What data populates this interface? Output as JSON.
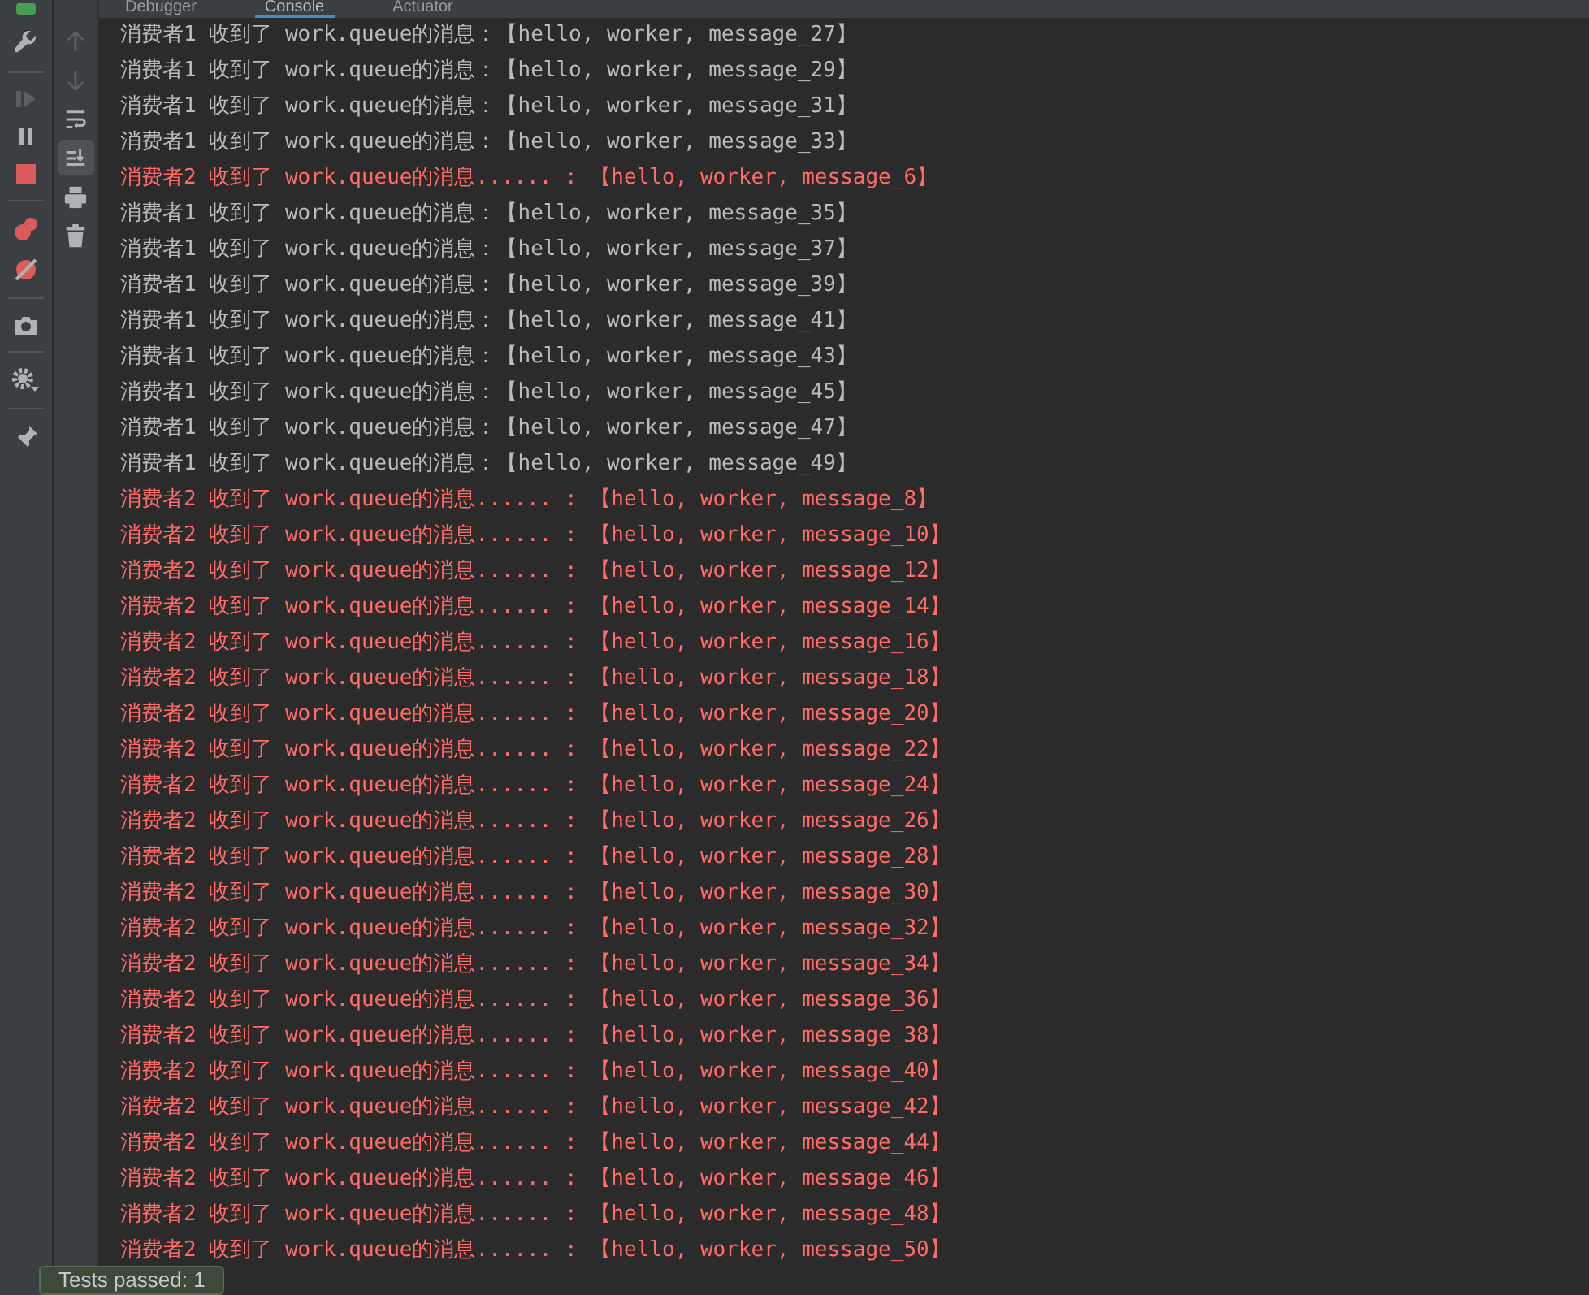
{
  "tabs": [
    {
      "label": "Debugger",
      "selected": false
    },
    {
      "label": "Console",
      "selected": true
    },
    {
      "label": "Actuator",
      "selected": false
    }
  ],
  "console_lines": [
    {
      "kind": "info",
      "text": "消费者1 收到了 work.queue的消息：【hello, worker, message_27】"
    },
    {
      "kind": "info",
      "text": "消费者1 收到了 work.queue的消息：【hello, worker, message_29】"
    },
    {
      "kind": "info",
      "text": "消费者1 收到了 work.queue的消息：【hello, worker, message_31】"
    },
    {
      "kind": "info",
      "text": "消费者1 收到了 work.queue的消息：【hello, worker, message_33】"
    },
    {
      "kind": "error",
      "text": "消费者2 收到了 work.queue的消息...... : 【hello, worker, message_6】"
    },
    {
      "kind": "info",
      "text": "消费者1 收到了 work.queue的消息：【hello, worker, message_35】"
    },
    {
      "kind": "info",
      "text": "消费者1 收到了 work.queue的消息：【hello, worker, message_37】"
    },
    {
      "kind": "info",
      "text": "消费者1 收到了 work.queue的消息：【hello, worker, message_39】"
    },
    {
      "kind": "info",
      "text": "消费者1 收到了 work.queue的消息：【hello, worker, message_41】"
    },
    {
      "kind": "info",
      "text": "消费者1 收到了 work.queue的消息：【hello, worker, message_43】"
    },
    {
      "kind": "info",
      "text": "消费者1 收到了 work.queue的消息：【hello, worker, message_45】"
    },
    {
      "kind": "info",
      "text": "消费者1 收到了 work.queue的消息：【hello, worker, message_47】"
    },
    {
      "kind": "info",
      "text": "消费者1 收到了 work.queue的消息：【hello, worker, message_49】"
    },
    {
      "kind": "error",
      "text": "消费者2 收到了 work.queue的消息...... : 【hello, worker, message_8】"
    },
    {
      "kind": "error",
      "text": "消费者2 收到了 work.queue的消息...... : 【hello, worker, message_10】"
    },
    {
      "kind": "error",
      "text": "消费者2 收到了 work.queue的消息...... : 【hello, worker, message_12】"
    },
    {
      "kind": "error",
      "text": "消费者2 收到了 work.queue的消息...... : 【hello, worker, message_14】"
    },
    {
      "kind": "error",
      "text": "消费者2 收到了 work.queue的消息...... : 【hello, worker, message_16】"
    },
    {
      "kind": "error",
      "text": "消费者2 收到了 work.queue的消息...... : 【hello, worker, message_18】"
    },
    {
      "kind": "error",
      "text": "消费者2 收到了 work.queue的消息...... : 【hello, worker, message_20】"
    },
    {
      "kind": "error",
      "text": "消费者2 收到了 work.queue的消息...... : 【hello, worker, message_22】"
    },
    {
      "kind": "error",
      "text": "消费者2 收到了 work.queue的消息...... : 【hello, worker, message_24】"
    },
    {
      "kind": "error",
      "text": "消费者2 收到了 work.queue的消息...... : 【hello, worker, message_26】"
    },
    {
      "kind": "error",
      "text": "消费者2 收到了 work.queue的消息...... : 【hello, worker, message_28】"
    },
    {
      "kind": "error",
      "text": "消费者2 收到了 work.queue的消息...... : 【hello, worker, message_30】"
    },
    {
      "kind": "error",
      "text": "消费者2 收到了 work.queue的消息...... : 【hello, worker, message_32】"
    },
    {
      "kind": "error",
      "text": "消费者2 收到了 work.queue的消息...... : 【hello, worker, message_34】"
    },
    {
      "kind": "error",
      "text": "消费者2 收到了 work.queue的消息...... : 【hello, worker, message_36】"
    },
    {
      "kind": "error",
      "text": "消费者2 收到了 work.queue的消息...... : 【hello, worker, message_38】"
    },
    {
      "kind": "error",
      "text": "消费者2 收到了 work.queue的消息...... : 【hello, worker, message_40】"
    },
    {
      "kind": "error",
      "text": "消费者2 收到了 work.queue的消息...... : 【hello, worker, message_42】"
    },
    {
      "kind": "error",
      "text": "消费者2 收到了 work.queue的消息...... : 【hello, worker, message_44】"
    },
    {
      "kind": "error",
      "text": "消费者2 收到了 work.queue的消息...... : 【hello, worker, message_46】"
    },
    {
      "kind": "error",
      "text": "消费者2 收到了 work.queue的消息...... : 【hello, worker, message_48】"
    },
    {
      "kind": "error",
      "text": "消费者2 收到了 work.queue的消息...... : 【hello, worker, message_50】"
    }
  ],
  "side_tools": [
    {
      "kind": "up",
      "disabled": true,
      "selected": false
    },
    {
      "kind": "down",
      "disabled": true,
      "selected": false
    },
    {
      "kind": "wrap",
      "disabled": false,
      "selected": false
    },
    {
      "kind": "scroll-end",
      "disabled": false,
      "selected": true
    },
    {
      "kind": "print",
      "disabled": false,
      "selected": false
    },
    {
      "kind": "trash",
      "disabled": false,
      "selected": false
    }
  ],
  "notification": {
    "text": "Tests passed: 1"
  }
}
